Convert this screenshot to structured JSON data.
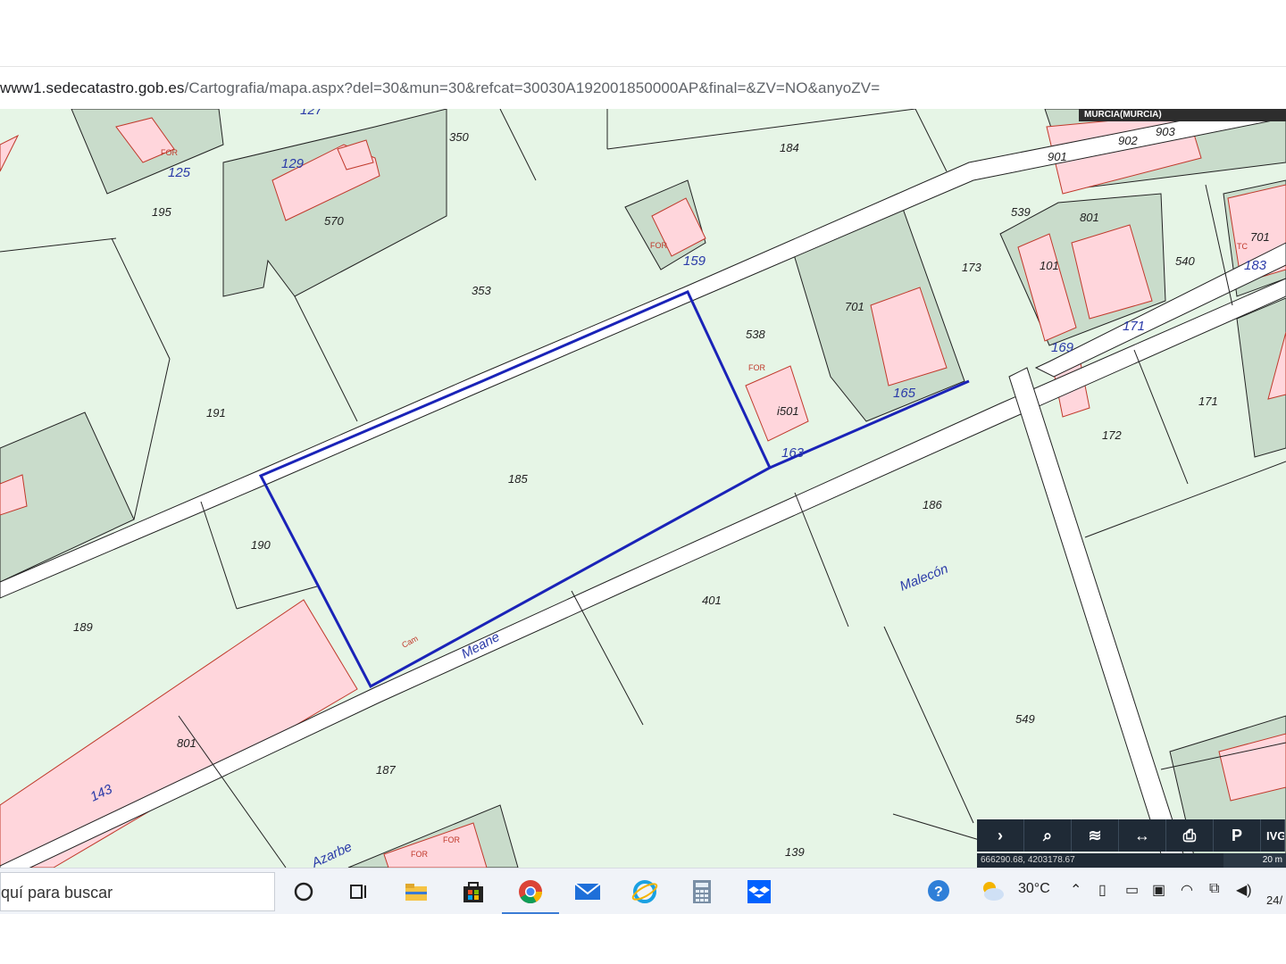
{
  "browser": {
    "url_host": "www1.sedecatastro.gob.es",
    "url_path": "/Cartografia/mapa.aspx?del=30&mun=30&refcat=30030A192001850000AP&final=&ZV=NO&anyoZV="
  },
  "map": {
    "municipality": "MURCIA(MURCIA)",
    "parcels": [
      "350",
      "184",
      "195",
      "570",
      "353",
      "191",
      "185",
      "190",
      "189",
      "187",
      "401",
      "186",
      "549",
      "139",
      "538",
      "501",
      "701",
      "173",
      "539",
      "540",
      "171",
      "172",
      "901",
      "902",
      "903",
      "801",
      "101",
      "701b"
    ],
    "blocks": [
      "125",
      "129",
      "159",
      "165",
      "163",
      "169",
      "171",
      "183",
      "143",
      "127"
    ],
    "streets": {
      "meane": "Meane",
      "malecon": "Malecón",
      "azarbe": "Azarbe"
    },
    "labels": {
      "p350": "350",
      "p184": "184",
      "p195": "195",
      "p570": "570",
      "p353": "353",
      "p191": "191",
      "p185": "185",
      "p190": "190",
      "p189": "189",
      "p187": "187",
      "p401": "401",
      "p186": "186",
      "p549": "549",
      "p139": "139",
      "p538": "538",
      "p501": "i501",
      "p701": "701",
      "p173": "173",
      "p539": "539",
      "p540": "540",
      "p171": "171",
      "p172": "172",
      "p901": "901",
      "p902": "902",
      "p903": "903",
      "p801": "801",
      "p801b": "801",
      "p101": "101",
      "p701b": "701",
      "b125": "125",
      "b129": "129",
      "b159": "159",
      "b165": "165",
      "b163": "163",
      "b169": "169",
      "b171": "171",
      "b183": "183",
      "b143": "143",
      "b127": "127",
      "cam": "Cam"
    },
    "colors": {
      "rustic": "#e6f5e6",
      "built": "#ffd6dc",
      "urban_block": "#c9dccb",
      "road": "#ffffff",
      "parcel_line": "#222222",
      "selected": "#1a23b8"
    }
  },
  "toolbar": {
    "buttons": [
      {
        "icon": "chevron-right-icon",
        "glyph": "›"
      },
      {
        "icon": "search-icon",
        "glyph": "⌕"
      },
      {
        "icon": "layers-icon",
        "glyph": "≋"
      },
      {
        "icon": "measure-icon",
        "glyph": "↔"
      },
      {
        "icon": "print-icon",
        "glyph": "⎙"
      },
      {
        "icon": "parcel-info-icon",
        "glyph": "P"
      },
      {
        "icon": "ivg-icon",
        "glyph": "IVG"
      }
    ],
    "coordinates": "666290.68, 4203178.67",
    "scale": "20 m"
  },
  "taskbar": {
    "search_placeholder": "quí para buscar",
    "weather": "30°C",
    "date_fragment": "24/"
  }
}
